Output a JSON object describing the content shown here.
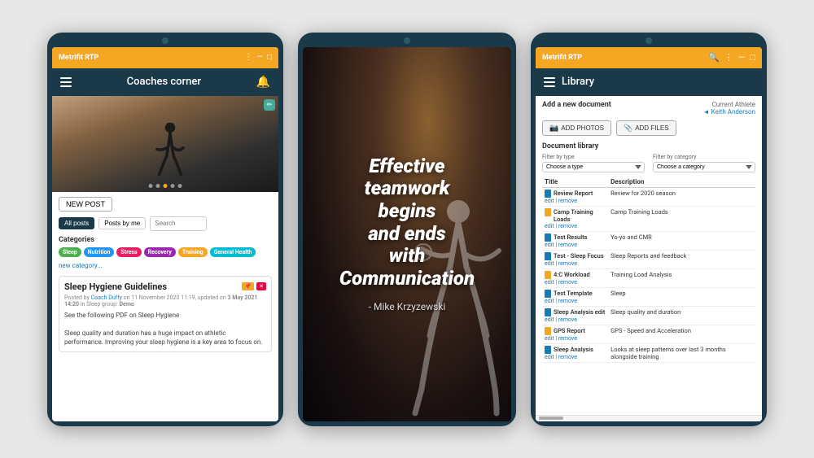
{
  "scene": {
    "bg_color": "#e8e8e8"
  },
  "left_tablet": {
    "topbar": {
      "title": "Metrifit RTP",
      "icons": [
        "dots",
        "minimize",
        "close"
      ]
    },
    "header": {
      "title": "Coaches corner"
    },
    "hero": {
      "edit_icon": "✏"
    },
    "new_post_btn": "NEW POST",
    "filter_buttons": [
      "All posts",
      "Posts by me"
    ],
    "search_placeholder": "Search",
    "categories_label": "Categories",
    "category_tags": [
      {
        "label": "Sleep",
        "color": "#4caf50"
      },
      {
        "label": "Nutrition",
        "color": "#2196f3"
      },
      {
        "label": "Stress",
        "color": "#e91e63"
      },
      {
        "label": "Recovery",
        "color": "#9c27b0"
      },
      {
        "label": "Training",
        "color": "#f5a623"
      },
      {
        "label": "General Health",
        "color": "#00bcd4"
      }
    ],
    "new_category_link": "new category...",
    "post": {
      "title": "Sleep Hygiene Guidelines",
      "badge_pin": "📌",
      "badge_delete": "✕",
      "meta": "Posted by Coach Duffy on 11 November 2020 11:19, updated on 3 May 2021 14:20 in Sleep group: Demo",
      "intro": "See the following PDF on Sleep Hygiene",
      "body": "Sleep quality and duration has a huge impact on athletic performance. Improving your sleep hygiene is a key area to focus on."
    }
  },
  "middle_tablet": {
    "quote": {
      "line1": "Effective",
      "line2": "teamwork",
      "line3": "begins",
      "line4": "and ends",
      "line5": "with",
      "line6": "Communication",
      "full_text": "Effective teamwork begins and ends with Communication",
      "author": "- Mike Krzyzewski"
    }
  },
  "right_tablet": {
    "topbar": {
      "title": "Metrifit RTP",
      "icons": [
        "search",
        "dots",
        "minimize",
        "close"
      ]
    },
    "header": {
      "title": "Library"
    },
    "add_doc_label": "Add a new document",
    "current_athlete_label": "Current Athlete",
    "athlete_name": "◄ Keith Anderson",
    "upload_buttons": [
      {
        "icon": "📷",
        "label": "ADD PHOTOS"
      },
      {
        "icon": "📎",
        "label": "ADD FILES"
      }
    ],
    "doc_library_label": "Document library",
    "filter_type_label": "Filter by type",
    "filter_type_placeholder": "Choose a type",
    "filter_category_label": "Filter by category",
    "filter_category_placeholder": "Choose a category",
    "table_headers": [
      "Title",
      "Description"
    ],
    "documents": [
      {
        "icon": "blue",
        "name": "Review Report",
        "actions": "edit | remove",
        "description": "Review for 2020 season"
      },
      {
        "icon": "orange",
        "name": "Camp Training Loads",
        "actions": "edit | remove",
        "description": "Camp Training Loads"
      },
      {
        "icon": "blue",
        "name": "Test Results",
        "actions": "edit | remove",
        "description": "Yo-yo and CMR"
      },
      {
        "icon": "blue",
        "name": "Test - Sleep Focus",
        "actions": "edit | remove",
        "description": "Sleep Reports and feedback"
      },
      {
        "icon": "orange",
        "name": "4:C Workload",
        "actions": "edit | remove",
        "description": "Training Load Analysis"
      },
      {
        "icon": "blue",
        "name": "Test Template",
        "actions": "edit | remove",
        "description": "Sleep"
      },
      {
        "icon": "blue",
        "name": "Sleep Analysis edit",
        "actions": "edit | remove",
        "description": "Sleep quality and duration"
      },
      {
        "icon": "orange",
        "name": "GPS Report",
        "actions": "edit | remove",
        "description": "GPS - Speed and Acceleration"
      },
      {
        "icon": "blue",
        "name": "Sleep Analysis",
        "actions": "edit | remove",
        "description": "Looks at sleep patterns over last 3 months alongside training"
      }
    ]
  }
}
